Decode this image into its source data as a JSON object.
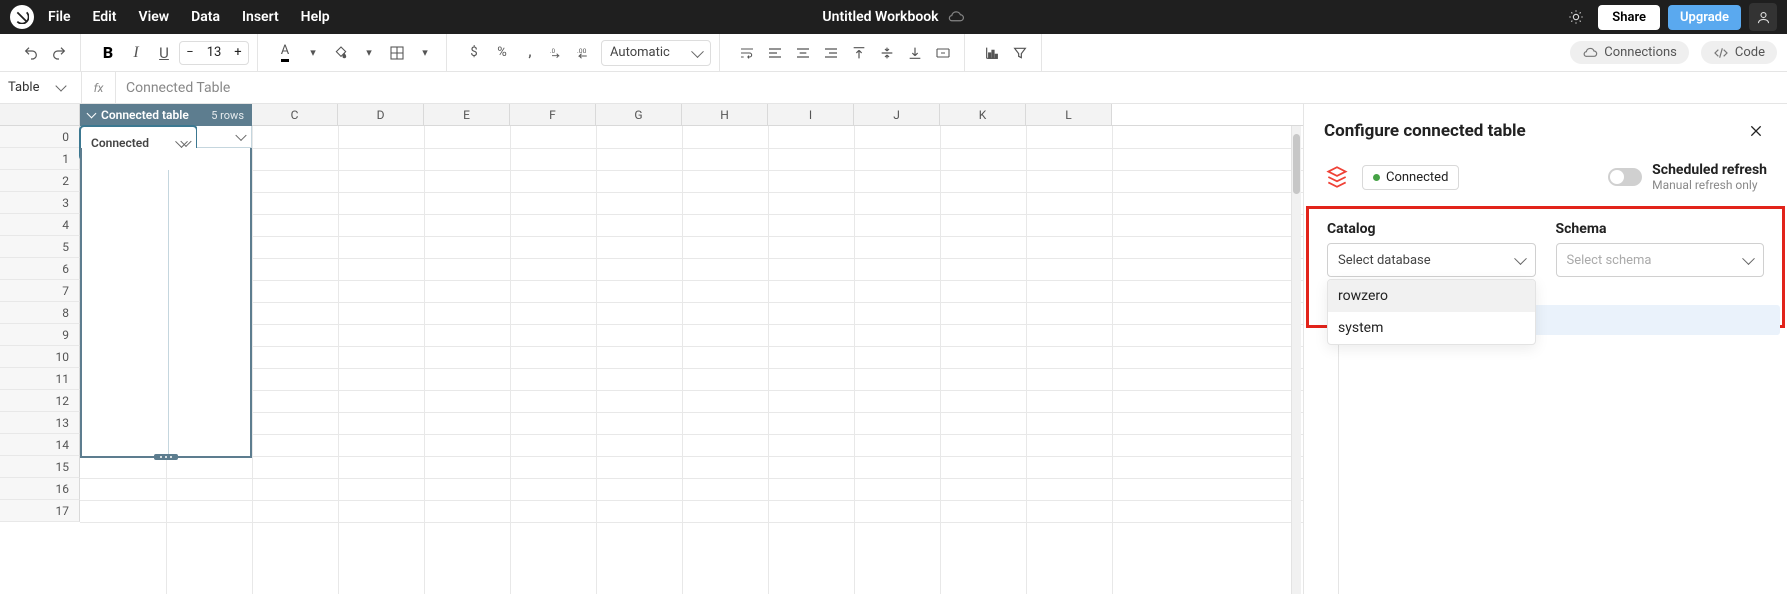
{
  "menubar": {
    "items": [
      "File",
      "Edit",
      "View",
      "Data",
      "Insert",
      "Help"
    ],
    "title": "Untitled Workbook",
    "share": "Share",
    "upgrade": "Upgrade"
  },
  "toolbar": {
    "fontsize": "13",
    "number_format": "Automatic",
    "connections": "Connections",
    "code": "Code"
  },
  "refbar": {
    "ref": "Table",
    "fx": "fx",
    "formula": "Connected Table"
  },
  "grid": {
    "columns": [
      "C",
      "D",
      "E",
      "F",
      "G",
      "H",
      "I",
      "J",
      "K",
      "L"
    ],
    "row_count": 18,
    "connected_table": {
      "header": "Connected table",
      "rows_label": "5 rows",
      "cell_a0": "Connected"
    }
  },
  "panel": {
    "title": "Configure connected table",
    "connected": "Connected",
    "scheduled_title": "Scheduled refresh",
    "scheduled_sub": "Manual refresh only",
    "catalog_label": "Catalog",
    "schema_label": "Schema",
    "catalog_placeholder": "Select database",
    "schema_placeholder": "Select schema",
    "catalog_options": [
      "rowzero",
      "system"
    ]
  }
}
